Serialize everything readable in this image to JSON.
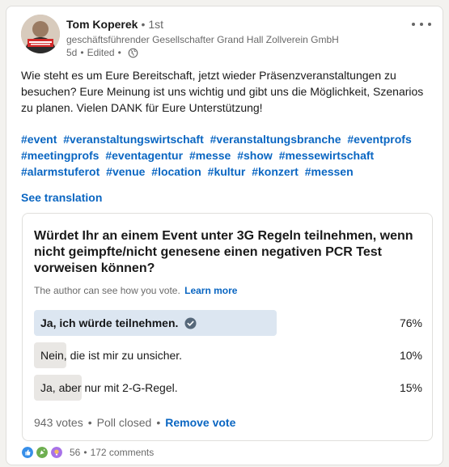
{
  "post": {
    "author": {
      "name": "Tom Koperek",
      "separator": "•",
      "degree": "1st",
      "title": "geschäftsführender Gesellschafter Grand Hall Zollverein GmbH",
      "time": "5d",
      "meta_sep": "•",
      "edited": "Edited",
      "meta_sep2": "•"
    },
    "text": "Wie steht es um Eure Bereitschaft, jetzt wieder Präsenzveranstaltungen zu besuchen? Eure Meinung ist uns wichtig und gibt uns die Möglichkeit, Szenarios zu planen. Vielen DANK für Eure Unterstützung!",
    "hashtags": [
      "#event",
      "#veranstaltungswirtschaft",
      "#veranstaltungsbranche",
      "#eventprofs",
      "#meetingprofs",
      "#eventagentur",
      "#messe",
      "#show",
      "#messewirtschaft",
      "#alarmstuferot",
      "#venue",
      "#location",
      "#kultur",
      "#konzert",
      "#messen"
    ],
    "see_translation": "See translation"
  },
  "poll": {
    "question": "Würdet Ihr an einem Event unter 3G Regeln teilnehmen, wenn nicht geimpfte/nicht genesene einen negativen PCR Test vorweisen können?",
    "note": "The author can see how you vote.",
    "learn_more": "Learn more",
    "options": [
      {
        "label": "Ja, ich würde teilnehmen.",
        "percent_label": "76%",
        "percent": 0.76,
        "selected": true
      },
      {
        "label": "Nein, die ist mir zu unsicher.",
        "percent_label": "10%",
        "percent": 0.1,
        "selected": false
      },
      {
        "label": "Ja, aber nur mit 2-G-Regel.",
        "percent_label": "15%",
        "percent": 0.15,
        "selected": false
      }
    ],
    "votes": "943 votes",
    "footer_sep": "•",
    "status": "Poll closed",
    "footer_sep2": "•",
    "remove_vote": "Remove vote"
  },
  "social": {
    "reactions": [
      "like-icon",
      "celebrate-icon",
      "insightful-icon"
    ],
    "reaction_count": "56",
    "sep": "•",
    "comments": "172 comments"
  },
  "colors": {
    "link": "#0a66c2",
    "selected_bar": "#dce6f1",
    "bar": "#e9e7e4"
  }
}
